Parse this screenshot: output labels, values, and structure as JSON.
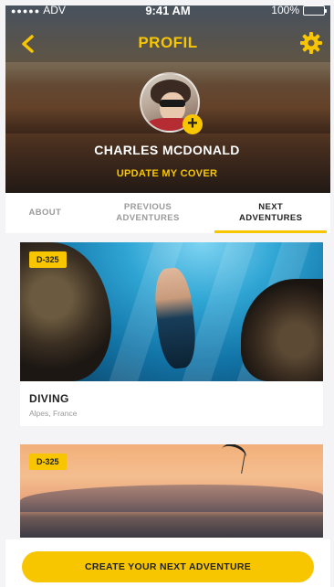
{
  "status_bar": {
    "signal": "●●●●●",
    "carrier": "ADV",
    "time": "9:41 AM",
    "battery": "100%"
  },
  "header": {
    "title": "PROFIL",
    "profile_name": "CHARLES MCDONALD",
    "update_cover": "UPDATE MY COVER",
    "add_icon_glyph": "+"
  },
  "tabs": [
    {
      "label": "ABOUT",
      "active": false
    },
    {
      "label": "PREVIOUS ADVENTURES",
      "active": false
    },
    {
      "label": "NEXT ADVENTURES",
      "active": true
    }
  ],
  "adventures": [
    {
      "badge": "D-325",
      "title": "DIVING",
      "location": "Alpes, France"
    },
    {
      "badge": "D-325",
      "title": "",
      "location": ""
    }
  ],
  "cta": {
    "label": "CREATE YOUR NEXT ADVENTURE"
  },
  "colors": {
    "accent": "#f7c600",
    "background": "#f4f4f6",
    "text": "#222222"
  },
  "icons": {
    "back": "chevron-left-icon",
    "settings": "gear-icon",
    "add": "plus-icon",
    "battery": "battery-icon"
  }
}
